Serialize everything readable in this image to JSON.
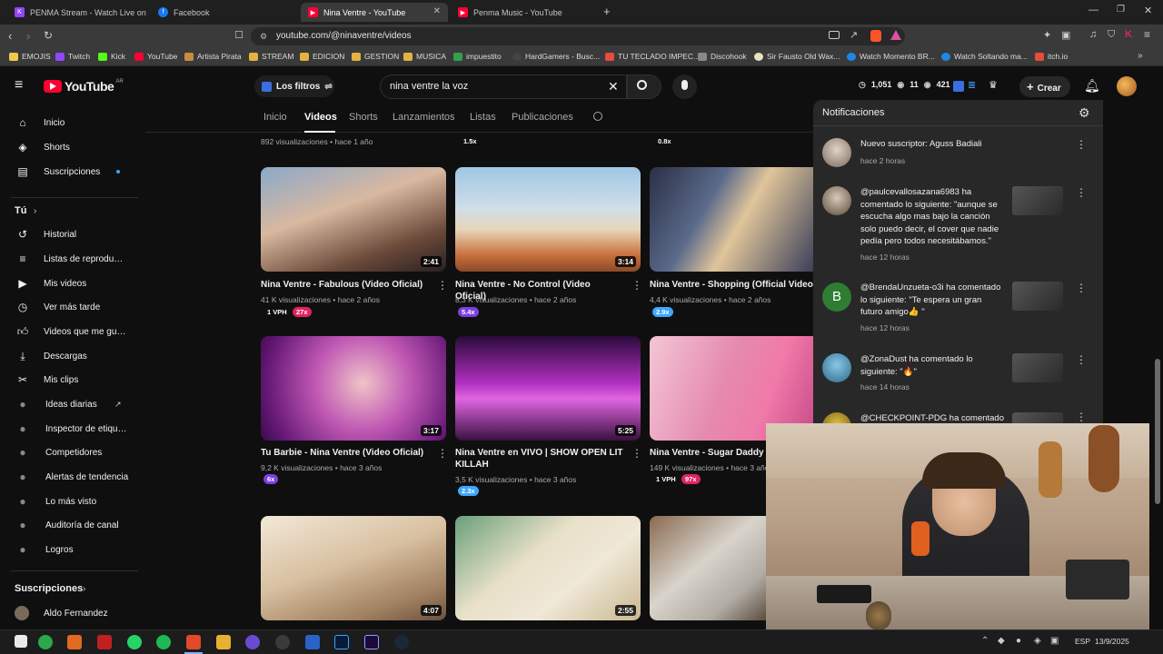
{
  "browser": {
    "tabs": [
      {
        "title": "PENMA Stream - Watch Live on",
        "active": false
      },
      {
        "title": "Facebook",
        "active": false
      },
      {
        "title": "Nina Ventre - YouTube",
        "active": true
      },
      {
        "title": "Penma Music - YouTube",
        "active": false
      }
    ],
    "url": "youtube.com/@ninaventre/videos",
    "bookmarks": [
      "EMOJIS",
      "Twitch",
      "Kick",
      "YouTube",
      "Artista Pirata",
      "STREAM",
      "EDICION",
      "GESTION",
      "MUSICA",
      "impuestito",
      "HardGamers - Busc...",
      "TU TECLADO IMPEC...",
      "Discohook",
      "Sir Fausto Old Wax...",
      "Watch Momento BR...",
      "Watch Soltando ma...",
      "itch.io"
    ]
  },
  "yt": {
    "logo": "YouTube",
    "country": "AR",
    "filters_label": "Los filtros",
    "search_value": "nina ventre la voz",
    "stats": {
      "a": "1,051",
      "b": "11",
      "c": "421"
    },
    "create_label": "Crear",
    "channel_tabs": [
      "Inicio",
      "Videos",
      "Shorts",
      "Lanzamientos",
      "Listas",
      "Publicaciones"
    ]
  },
  "sidebar": {
    "main": [
      "Inicio",
      "Shorts",
      "Suscripciones"
    ],
    "you_heading": "Tú",
    "you": [
      "Historial",
      "Listas de reproducc...",
      "Mis videos",
      "Ver más tarde",
      "Videos que me gus...",
      "Descargas",
      "Mis clips"
    ],
    "tools": [
      "Ideas diarias",
      "Inspector de etique...",
      "Competidores",
      "Alertas de tendencia",
      "Lo más visto",
      "Auditoría de canal",
      "Logros"
    ],
    "subs_heading": "Suscripciones",
    "subs": [
      "Aldo Fernandez"
    ]
  },
  "top_row": {
    "meta": "892 visualizaciones • hace 1 año",
    "pill1": "1.5x",
    "pill2": "0.8x"
  },
  "videos": [
    {
      "title": "Nina Ventre - Fabulous (Video Oficial)",
      "meta": "41 K visualizaciones • hace 2 años",
      "duration": "2:41",
      "badges": [
        "1 VPH",
        "27x"
      ]
    },
    {
      "title": "Nina Ventre - No Control (Video Oficial)",
      "meta": "8,3 K visualizaciones • hace 2 años",
      "duration": "3:14",
      "badges": [
        "5.4x"
      ]
    },
    {
      "title": "Nina Ventre - Shopping (Official Video)",
      "meta": "4,4 K visualizaciones • hace 2 años",
      "duration": "",
      "badges": [
        "2.9x"
      ]
    },
    {
      "title": "Tu Barbie - Nina Ventre (Video Oficial)",
      "meta": "9,2 K visualizaciones • hace 3 años",
      "duration": "3:17",
      "badges": [
        "6x"
      ]
    },
    {
      "title": "Nina Ventre en VIVO | SHOW OPEN LIT KILLAH",
      "meta": "3,5 K visualizaciones • hace 3 años",
      "duration": "5:25",
      "badges": [
        "2.3x"
      ]
    },
    {
      "title": "Nina Ventre - Sugar Daddy (Vid",
      "meta": "149 K visualizaciones • hace 3 años",
      "duration": "",
      "badges": [
        "1 VPH",
        "97x"
      ]
    },
    {
      "title": "",
      "meta": "",
      "duration": "4:07",
      "badges": []
    },
    {
      "title": "",
      "meta": "",
      "duration": "2:55",
      "badges": []
    },
    {
      "title": "",
      "meta": "",
      "duration": "",
      "badges": []
    }
  ],
  "notifications": {
    "title": "Notificaciones",
    "items": [
      {
        "text": "Nuevo suscriptor: Aguss Badiali",
        "time": "hace 2 horas"
      },
      {
        "text": "@paulcevallosazana6983 ha comentado lo siguiente: \"aunque se escucha algo mas bajo la canción solo puedo decir, el cover que nadie pedía pero todos necesitábamos.\"",
        "time": "hace 12 horas"
      },
      {
        "text": "@BrendaUnzueta-o3i ha comentado lo siguiente: \"Te espera un gran futuro amigo👍 \"",
        "time": "hace 12 horas",
        "avatar_letter": "B"
      },
      {
        "text": "@ZonaDust ha comentado lo siguiente: \"🔥\"",
        "time": "hace 14 horas"
      },
      {
        "text": "@CHECKPOINT-PDG ha comentado",
        "time": ""
      }
    ]
  },
  "taskbar": {
    "lang": "ESP",
    "date": "13/9/2025"
  },
  "colors": {
    "accent_red": "#ff0033",
    "pill_blue": "#3ea6ff",
    "pill_red": "#e0245e",
    "pill_purple": "#7b3fe4"
  }
}
